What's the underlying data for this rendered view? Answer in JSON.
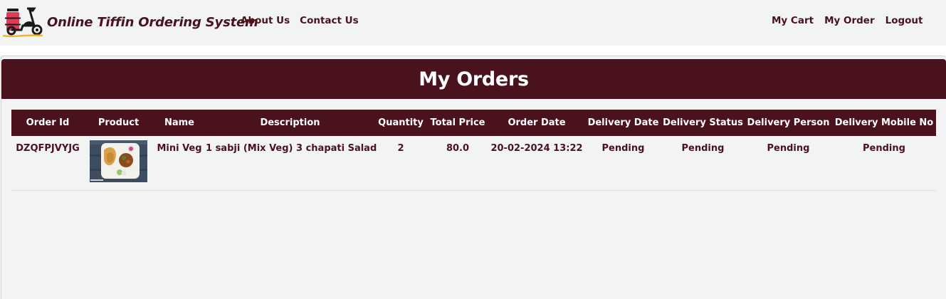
{
  "brand": {
    "title": "Online Tiffin Ordering System",
    "logo_icon": "delivery-scooter-tiffin-icon"
  },
  "nav": {
    "left": [
      {
        "label": "About Us"
      },
      {
        "label": "Contact Us"
      }
    ],
    "right": [
      {
        "label": "My Cart"
      },
      {
        "label": "My Order"
      },
      {
        "label": "Logout"
      }
    ]
  },
  "page": {
    "title": "My Orders"
  },
  "colors": {
    "primary": "#4a121c",
    "background": "#f2f3f3",
    "header_text": "#ffffff"
  },
  "orders_table": {
    "columns": [
      "Order Id",
      "Product",
      "Name",
      "Description",
      "Quantity",
      "Total Price",
      "Order Date",
      "Delivery Date",
      "Delivery Status",
      "Delivery Person",
      "Delivery Mobile No"
    ],
    "rows": [
      {
        "order_id": "DZQFPJVYJG",
        "product_image": "food-plate-thumbnail",
        "name": "Mini Veg",
        "description": "1 sabji (Mix Veg) 3 chapati Salad",
        "quantity": "2",
        "total_price": "80.0",
        "order_date": "20-02-2024 13:22",
        "delivery_date": "Pending",
        "delivery_status": "Pending",
        "delivery_person": "Pending",
        "delivery_mobile": "Pending"
      }
    ]
  }
}
